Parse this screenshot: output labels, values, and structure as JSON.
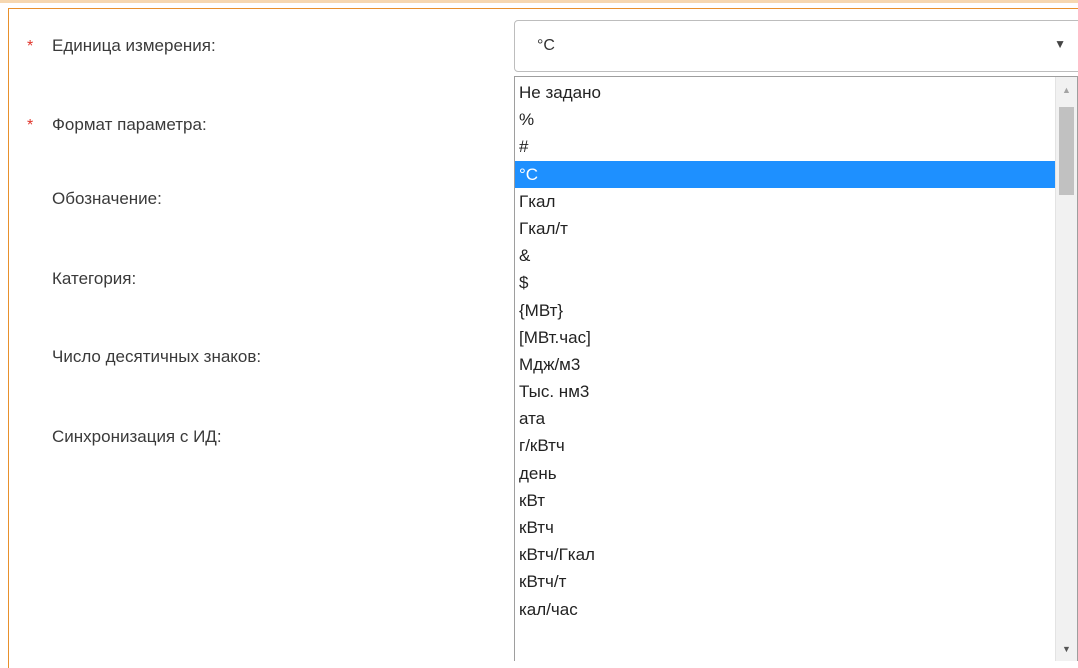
{
  "form": {
    "fields": [
      {
        "label": "Единица измерения:",
        "required": true
      },
      {
        "label": "Формат параметра:",
        "required": true
      },
      {
        "label": "Обозначение:",
        "required": false
      },
      {
        "label": "Категория:",
        "required": false
      },
      {
        "label": "Число десятичных знаков:",
        "required": false
      },
      {
        "label": "Синхронизация с ИД:",
        "required": false
      }
    ],
    "required_marker": "*"
  },
  "unit_select": {
    "value": "°C",
    "options": [
      "Не задано",
      "%",
      "#",
      "°C",
      "Гкал",
      "Гкал/т",
      "&",
      "$",
      "{МВт}",
      "[МВт.час]",
      "Мдж/м3",
      "Тыс. нм3",
      "ата",
      "г/кВтч",
      "день",
      "кВт",
      "кВтч",
      "кВтч/Гкал",
      "кВтч/т",
      "кал/час"
    ],
    "selected_option": "°C"
  },
  "icons": {
    "select_arrow": "chevron-down-icon",
    "scroll_up": "scroll-up-arrow-icon",
    "scroll_down": "scroll-down-arrow-icon"
  },
  "colors": {
    "frame_border": "#e8902c",
    "required_marker": "#e0342a",
    "selected_option_bg": "#1e90ff"
  }
}
